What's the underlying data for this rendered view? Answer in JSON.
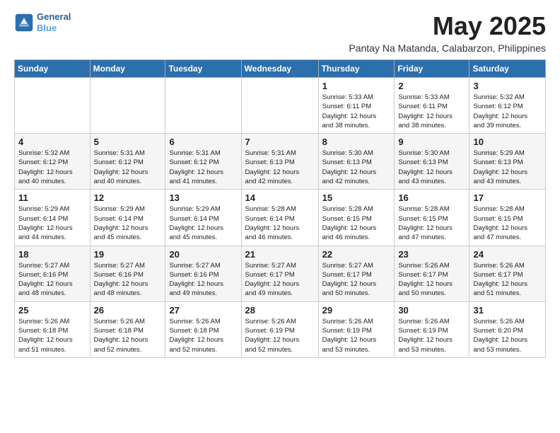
{
  "header": {
    "logo_line1": "General",
    "logo_line2": "Blue",
    "month": "May 2025",
    "location": "Pantay Na Matanda, Calabarzon, Philippines"
  },
  "weekdays": [
    "Sunday",
    "Monday",
    "Tuesday",
    "Wednesday",
    "Thursday",
    "Friday",
    "Saturday"
  ],
  "weeks": [
    [
      {
        "day": null,
        "info": null
      },
      {
        "day": null,
        "info": null
      },
      {
        "day": null,
        "info": null
      },
      {
        "day": null,
        "info": null
      },
      {
        "day": "1",
        "info": "Sunrise: 5:33 AM\nSunset: 6:11 PM\nDaylight: 12 hours\nand 38 minutes."
      },
      {
        "day": "2",
        "info": "Sunrise: 5:33 AM\nSunset: 6:11 PM\nDaylight: 12 hours\nand 38 minutes."
      },
      {
        "day": "3",
        "info": "Sunrise: 5:32 AM\nSunset: 6:12 PM\nDaylight: 12 hours\nand 39 minutes."
      }
    ],
    [
      {
        "day": "4",
        "info": "Sunrise: 5:32 AM\nSunset: 6:12 PM\nDaylight: 12 hours\nand 40 minutes."
      },
      {
        "day": "5",
        "info": "Sunrise: 5:31 AM\nSunset: 6:12 PM\nDaylight: 12 hours\nand 40 minutes."
      },
      {
        "day": "6",
        "info": "Sunrise: 5:31 AM\nSunset: 6:12 PM\nDaylight: 12 hours\nand 41 minutes."
      },
      {
        "day": "7",
        "info": "Sunrise: 5:31 AM\nSunset: 6:13 PM\nDaylight: 12 hours\nand 42 minutes."
      },
      {
        "day": "8",
        "info": "Sunrise: 5:30 AM\nSunset: 6:13 PM\nDaylight: 12 hours\nand 42 minutes."
      },
      {
        "day": "9",
        "info": "Sunrise: 5:30 AM\nSunset: 6:13 PM\nDaylight: 12 hours\nand 43 minutes."
      },
      {
        "day": "10",
        "info": "Sunrise: 5:29 AM\nSunset: 6:13 PM\nDaylight: 12 hours\nand 43 minutes."
      }
    ],
    [
      {
        "day": "11",
        "info": "Sunrise: 5:29 AM\nSunset: 6:14 PM\nDaylight: 12 hours\nand 44 minutes."
      },
      {
        "day": "12",
        "info": "Sunrise: 5:29 AM\nSunset: 6:14 PM\nDaylight: 12 hours\nand 45 minutes."
      },
      {
        "day": "13",
        "info": "Sunrise: 5:29 AM\nSunset: 6:14 PM\nDaylight: 12 hours\nand 45 minutes."
      },
      {
        "day": "14",
        "info": "Sunrise: 5:28 AM\nSunset: 6:14 PM\nDaylight: 12 hours\nand 46 minutes."
      },
      {
        "day": "15",
        "info": "Sunrise: 5:28 AM\nSunset: 6:15 PM\nDaylight: 12 hours\nand 46 minutes."
      },
      {
        "day": "16",
        "info": "Sunrise: 5:28 AM\nSunset: 6:15 PM\nDaylight: 12 hours\nand 47 minutes."
      },
      {
        "day": "17",
        "info": "Sunrise: 5:28 AM\nSunset: 6:15 PM\nDaylight: 12 hours\nand 47 minutes."
      }
    ],
    [
      {
        "day": "18",
        "info": "Sunrise: 5:27 AM\nSunset: 6:16 PM\nDaylight: 12 hours\nand 48 minutes."
      },
      {
        "day": "19",
        "info": "Sunrise: 5:27 AM\nSunset: 6:16 PM\nDaylight: 12 hours\nand 48 minutes."
      },
      {
        "day": "20",
        "info": "Sunrise: 5:27 AM\nSunset: 6:16 PM\nDaylight: 12 hours\nand 49 minutes."
      },
      {
        "day": "21",
        "info": "Sunrise: 5:27 AM\nSunset: 6:17 PM\nDaylight: 12 hours\nand 49 minutes."
      },
      {
        "day": "22",
        "info": "Sunrise: 5:27 AM\nSunset: 6:17 PM\nDaylight: 12 hours\nand 50 minutes."
      },
      {
        "day": "23",
        "info": "Sunrise: 5:26 AM\nSunset: 6:17 PM\nDaylight: 12 hours\nand 50 minutes."
      },
      {
        "day": "24",
        "info": "Sunrise: 5:26 AM\nSunset: 6:17 PM\nDaylight: 12 hours\nand 51 minutes."
      }
    ],
    [
      {
        "day": "25",
        "info": "Sunrise: 5:26 AM\nSunset: 6:18 PM\nDaylight: 12 hours\nand 51 minutes."
      },
      {
        "day": "26",
        "info": "Sunrise: 5:26 AM\nSunset: 6:18 PM\nDaylight: 12 hours\nand 52 minutes."
      },
      {
        "day": "27",
        "info": "Sunrise: 5:26 AM\nSunset: 6:18 PM\nDaylight: 12 hours\nand 52 minutes."
      },
      {
        "day": "28",
        "info": "Sunrise: 5:26 AM\nSunset: 6:19 PM\nDaylight: 12 hours\nand 52 minutes."
      },
      {
        "day": "29",
        "info": "Sunrise: 5:26 AM\nSunset: 6:19 PM\nDaylight: 12 hours\nand 53 minutes."
      },
      {
        "day": "30",
        "info": "Sunrise: 5:26 AM\nSunset: 6:19 PM\nDaylight: 12 hours\nand 53 minutes."
      },
      {
        "day": "31",
        "info": "Sunrise: 5:26 AM\nSunset: 6:20 PM\nDaylight: 12 hours\nand 53 minutes."
      }
    ]
  ]
}
